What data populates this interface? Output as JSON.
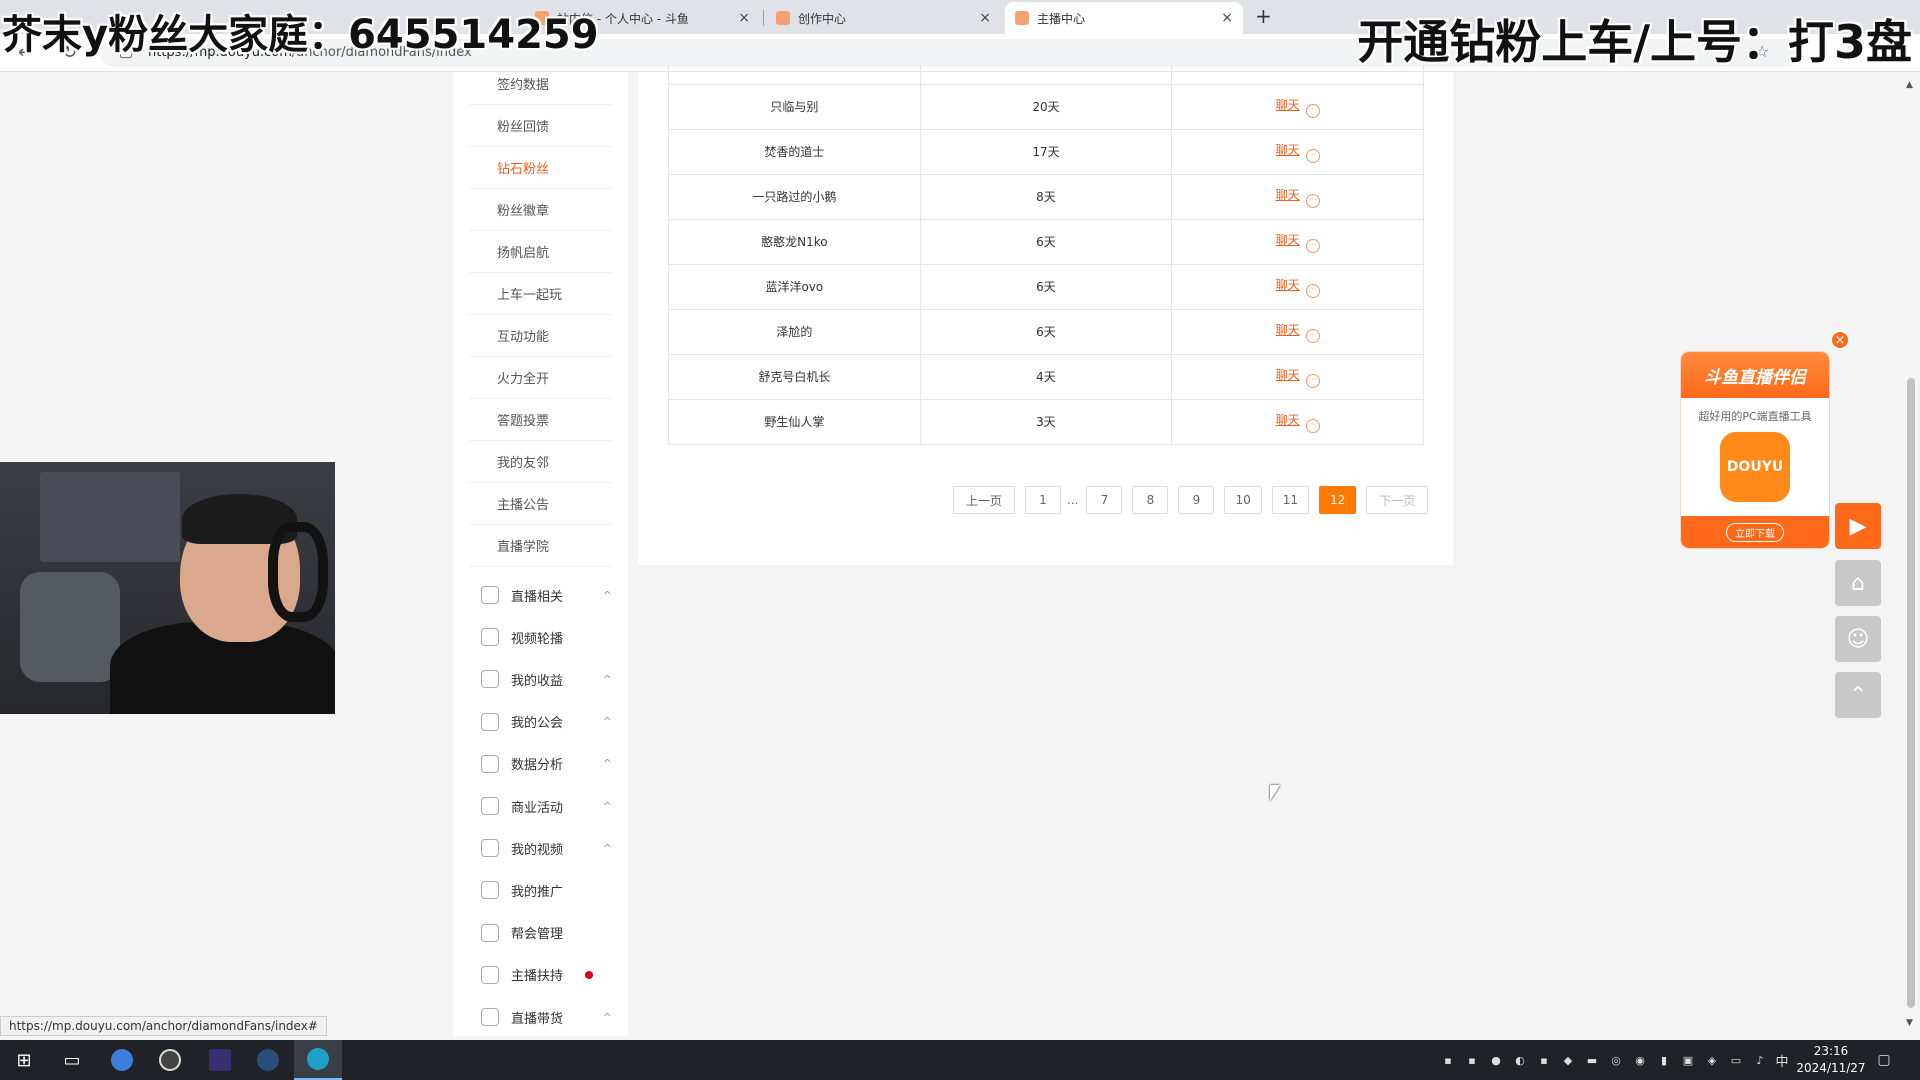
{
  "browser": {
    "tabs": [
      {
        "title": "站内信 - 个人中心 - 斗鱼",
        "close": "×"
      },
      {
        "title": "创作中心",
        "close": "×"
      },
      {
        "title": "主播中心",
        "close": "×"
      }
    ],
    "new_tab": "+",
    "url_host": "https://mp.douyu.com",
    "url_path": "/anchor/diamondFans/index",
    "status_url": "https://mp.douyu.com/anchor/diamondFans/index#"
  },
  "overlays": {
    "left": "芥末y粉丝大家庭：645514259",
    "right": "开通钻粉上车/上号：打3盘"
  },
  "sidebar": {
    "subitems": [
      {
        "label": "签约数据"
      },
      {
        "label": "粉丝回馈"
      },
      {
        "label": "钻石粉丝",
        "active": true
      },
      {
        "label": "粉丝徽章"
      },
      {
        "label": "扬帆启航"
      },
      {
        "label": "上车一起玩"
      },
      {
        "label": "互动功能"
      },
      {
        "label": "火力全开"
      },
      {
        "label": "答题投票"
      },
      {
        "label": "我的友邻"
      },
      {
        "label": "主播公告"
      },
      {
        "label": "直播学院"
      }
    ],
    "groups": [
      {
        "label": "直播相关",
        "icon": "video-camera-icon",
        "caret": "^"
      },
      {
        "label": "视频轮播",
        "icon": "carousel-icon",
        "caret": ""
      },
      {
        "label": "我的收益",
        "icon": "money-bag-icon",
        "caret": "^"
      },
      {
        "label": "我的公会",
        "icon": "shield-icon",
        "caret": "^"
      },
      {
        "label": "数据分析",
        "icon": "pie-chart-icon",
        "caret": "^"
      },
      {
        "label": "商业活动",
        "icon": "building-icon",
        "caret": "^"
      },
      {
        "label": "我的视频",
        "icon": "film-icon",
        "caret": "^"
      },
      {
        "label": "我的推广",
        "icon": "microphone-icon",
        "caret": ""
      },
      {
        "label": "帮会管理",
        "icon": "gear-icon",
        "caret": ""
      },
      {
        "label": "主播扶持",
        "icon": "thumbs-up-icon",
        "caret": "",
        "dot": true
      },
      {
        "label": "直播带货",
        "icon": "shopping-bag-icon",
        "caret": "^"
      }
    ]
  },
  "fans_table": {
    "rows": [
      {
        "name": "只临与别",
        "days": "20天",
        "action": "聊天"
      },
      {
        "name": "焚香的道士",
        "days": "17天",
        "action": "聊天"
      },
      {
        "name": "一只路过的小鹅",
        "days": "8天",
        "action": "聊天"
      },
      {
        "name": "憨憨龙N1ko",
        "days": "6天",
        "action": "聊天"
      },
      {
        "name": "蓝洋洋ovo",
        "days": "6天",
        "action": "聊天"
      },
      {
        "name": "泽尬的",
        "days": "6天",
        "action": "聊天"
      },
      {
        "name": "舒克号白机长",
        "days": "4天",
        "action": "聊天"
      },
      {
        "name": "野生仙人掌",
        "days": "3天",
        "action": "聊天"
      }
    ]
  },
  "pagination": {
    "prev": "上一页",
    "pages": [
      "1",
      "7",
      "8",
      "9",
      "10",
      "11",
      "12"
    ],
    "ellipsis": "...",
    "current": "12",
    "next": "下一页"
  },
  "ad": {
    "title": "斗鱼直播伴侣",
    "subtitle": "超好用的PC端直播工具",
    "logo_text": "DOUYU",
    "button": "立即下载",
    "close": "×"
  },
  "float_buttons": [
    {
      "name": "replay-icon",
      "glyph": "▶"
    },
    {
      "name": "home-icon",
      "glyph": "⌂"
    },
    {
      "name": "robot-icon",
      "glyph": "☺"
    },
    {
      "name": "back-to-top-icon",
      "glyph": "⌃"
    }
  ],
  "taskbar": {
    "time": "23:16",
    "date": "2024/11/27",
    "ime": "中"
  },
  "colors": {
    "accent": "#ef5f1e",
    "page_current": "#ff7a00",
    "taskbar": "#1f2327"
  }
}
